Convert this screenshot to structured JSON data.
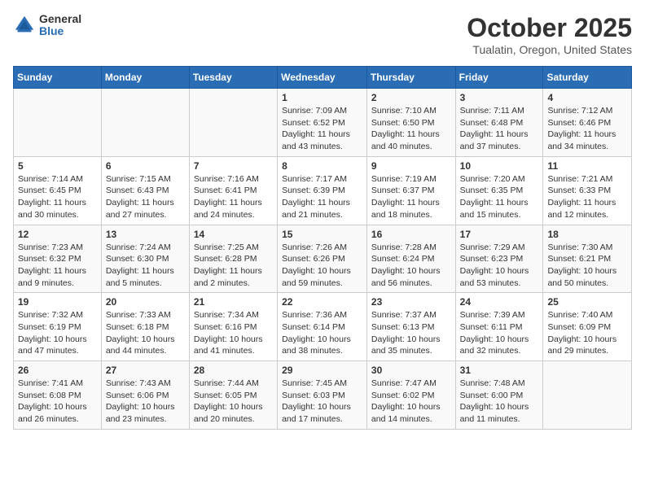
{
  "header": {
    "logo_general": "General",
    "logo_blue": "Blue",
    "title": "October 2025",
    "subtitle": "Tualatin, Oregon, United States"
  },
  "weekdays": [
    "Sunday",
    "Monday",
    "Tuesday",
    "Wednesday",
    "Thursday",
    "Friday",
    "Saturday"
  ],
  "weeks": [
    [
      {
        "day": "",
        "info": ""
      },
      {
        "day": "",
        "info": ""
      },
      {
        "day": "",
        "info": ""
      },
      {
        "day": "1",
        "info": "Sunrise: 7:09 AM\nSunset: 6:52 PM\nDaylight: 11 hours and 43 minutes."
      },
      {
        "day": "2",
        "info": "Sunrise: 7:10 AM\nSunset: 6:50 PM\nDaylight: 11 hours and 40 minutes."
      },
      {
        "day": "3",
        "info": "Sunrise: 7:11 AM\nSunset: 6:48 PM\nDaylight: 11 hours and 37 minutes."
      },
      {
        "day": "4",
        "info": "Sunrise: 7:12 AM\nSunset: 6:46 PM\nDaylight: 11 hours and 34 minutes."
      }
    ],
    [
      {
        "day": "5",
        "info": "Sunrise: 7:14 AM\nSunset: 6:45 PM\nDaylight: 11 hours and 30 minutes."
      },
      {
        "day": "6",
        "info": "Sunrise: 7:15 AM\nSunset: 6:43 PM\nDaylight: 11 hours and 27 minutes."
      },
      {
        "day": "7",
        "info": "Sunrise: 7:16 AM\nSunset: 6:41 PM\nDaylight: 11 hours and 24 minutes."
      },
      {
        "day": "8",
        "info": "Sunrise: 7:17 AM\nSunset: 6:39 PM\nDaylight: 11 hours and 21 minutes."
      },
      {
        "day": "9",
        "info": "Sunrise: 7:19 AM\nSunset: 6:37 PM\nDaylight: 11 hours and 18 minutes."
      },
      {
        "day": "10",
        "info": "Sunrise: 7:20 AM\nSunset: 6:35 PM\nDaylight: 11 hours and 15 minutes."
      },
      {
        "day": "11",
        "info": "Sunrise: 7:21 AM\nSunset: 6:33 PM\nDaylight: 11 hours and 12 minutes."
      }
    ],
    [
      {
        "day": "12",
        "info": "Sunrise: 7:23 AM\nSunset: 6:32 PM\nDaylight: 11 hours and 9 minutes."
      },
      {
        "day": "13",
        "info": "Sunrise: 7:24 AM\nSunset: 6:30 PM\nDaylight: 11 hours and 5 minutes."
      },
      {
        "day": "14",
        "info": "Sunrise: 7:25 AM\nSunset: 6:28 PM\nDaylight: 11 hours and 2 minutes."
      },
      {
        "day": "15",
        "info": "Sunrise: 7:26 AM\nSunset: 6:26 PM\nDaylight: 10 hours and 59 minutes."
      },
      {
        "day": "16",
        "info": "Sunrise: 7:28 AM\nSunset: 6:24 PM\nDaylight: 10 hours and 56 minutes."
      },
      {
        "day": "17",
        "info": "Sunrise: 7:29 AM\nSunset: 6:23 PM\nDaylight: 10 hours and 53 minutes."
      },
      {
        "day": "18",
        "info": "Sunrise: 7:30 AM\nSunset: 6:21 PM\nDaylight: 10 hours and 50 minutes."
      }
    ],
    [
      {
        "day": "19",
        "info": "Sunrise: 7:32 AM\nSunset: 6:19 PM\nDaylight: 10 hours and 47 minutes."
      },
      {
        "day": "20",
        "info": "Sunrise: 7:33 AM\nSunset: 6:18 PM\nDaylight: 10 hours and 44 minutes."
      },
      {
        "day": "21",
        "info": "Sunrise: 7:34 AM\nSunset: 6:16 PM\nDaylight: 10 hours and 41 minutes."
      },
      {
        "day": "22",
        "info": "Sunrise: 7:36 AM\nSunset: 6:14 PM\nDaylight: 10 hours and 38 minutes."
      },
      {
        "day": "23",
        "info": "Sunrise: 7:37 AM\nSunset: 6:13 PM\nDaylight: 10 hours and 35 minutes."
      },
      {
        "day": "24",
        "info": "Sunrise: 7:39 AM\nSunset: 6:11 PM\nDaylight: 10 hours and 32 minutes."
      },
      {
        "day": "25",
        "info": "Sunrise: 7:40 AM\nSunset: 6:09 PM\nDaylight: 10 hours and 29 minutes."
      }
    ],
    [
      {
        "day": "26",
        "info": "Sunrise: 7:41 AM\nSunset: 6:08 PM\nDaylight: 10 hours and 26 minutes."
      },
      {
        "day": "27",
        "info": "Sunrise: 7:43 AM\nSunset: 6:06 PM\nDaylight: 10 hours and 23 minutes."
      },
      {
        "day": "28",
        "info": "Sunrise: 7:44 AM\nSunset: 6:05 PM\nDaylight: 10 hours and 20 minutes."
      },
      {
        "day": "29",
        "info": "Sunrise: 7:45 AM\nSunset: 6:03 PM\nDaylight: 10 hours and 17 minutes."
      },
      {
        "day": "30",
        "info": "Sunrise: 7:47 AM\nSunset: 6:02 PM\nDaylight: 10 hours and 14 minutes."
      },
      {
        "day": "31",
        "info": "Sunrise: 7:48 AM\nSunset: 6:00 PM\nDaylight: 10 hours and 11 minutes."
      },
      {
        "day": "",
        "info": ""
      }
    ]
  ]
}
